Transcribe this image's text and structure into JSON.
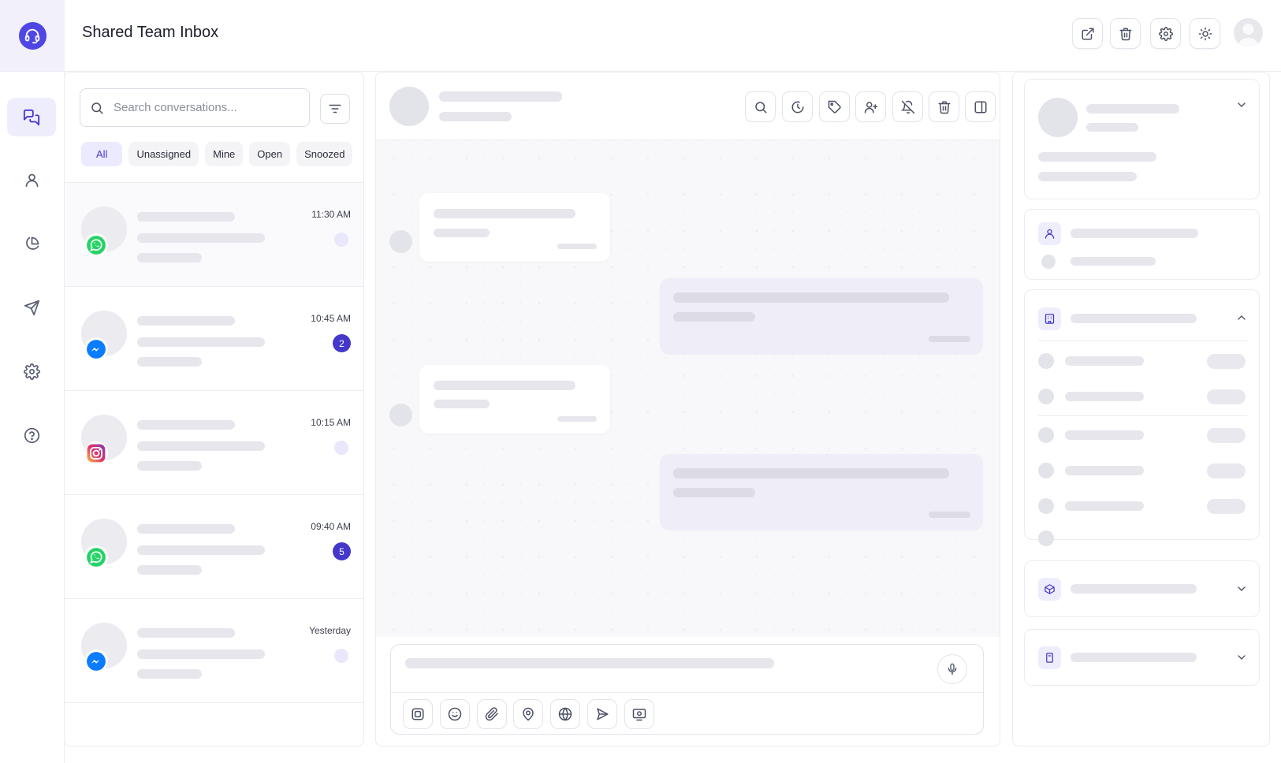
{
  "app": {
    "title": "Shared Team Inbox"
  },
  "rail": {
    "items": [
      {
        "icon": "chat-bubbles-icon",
        "active": true
      },
      {
        "icon": "user-icon",
        "active": false
      },
      {
        "icon": "pie-chart-icon",
        "active": false
      },
      {
        "icon": "send-icon",
        "active": false
      },
      {
        "icon": "gear-icon",
        "active": false
      },
      {
        "icon": "help-circle-icon",
        "active": false
      }
    ]
  },
  "header": {
    "actions": [
      "external-link-icon",
      "trash-icon",
      "gear-icon",
      "sun-icon"
    ]
  },
  "search": {
    "placeholder": "Search conversations..."
  },
  "filters": {
    "tabs": [
      "All",
      "Unassigned",
      "Mine",
      "Open",
      "Snoozed"
    ],
    "active": "All"
  },
  "conversations": [
    {
      "channel": "whatsapp",
      "time": "11:30 AM",
      "unread": null
    },
    {
      "channel": "messenger",
      "time": "10:45 AM",
      "unread": "2"
    },
    {
      "channel": "instagram",
      "time": "10:15 AM",
      "unread": null
    },
    {
      "channel": "whatsapp",
      "time": "09:40 AM",
      "unread": "5"
    },
    {
      "channel": "messenger",
      "time": "Yesterday",
      "unread": null
    }
  ],
  "chat": {
    "header_actions": [
      "search-icon",
      "snooze-icon",
      "tag-icon",
      "assign-user-icon",
      "mute-icon",
      "trash-icon",
      "panel-toggle-icon"
    ],
    "composer_tools": [
      "template-icon",
      "emoji-icon",
      "attachment-icon",
      "location-icon",
      "globe-icon",
      "send-icon",
      "media-icon"
    ]
  },
  "colors": {
    "accent": "#4338ca",
    "brand": "#4f46e5",
    "whatsapp": "#25d366",
    "messenger": "#0a7cff"
  }
}
